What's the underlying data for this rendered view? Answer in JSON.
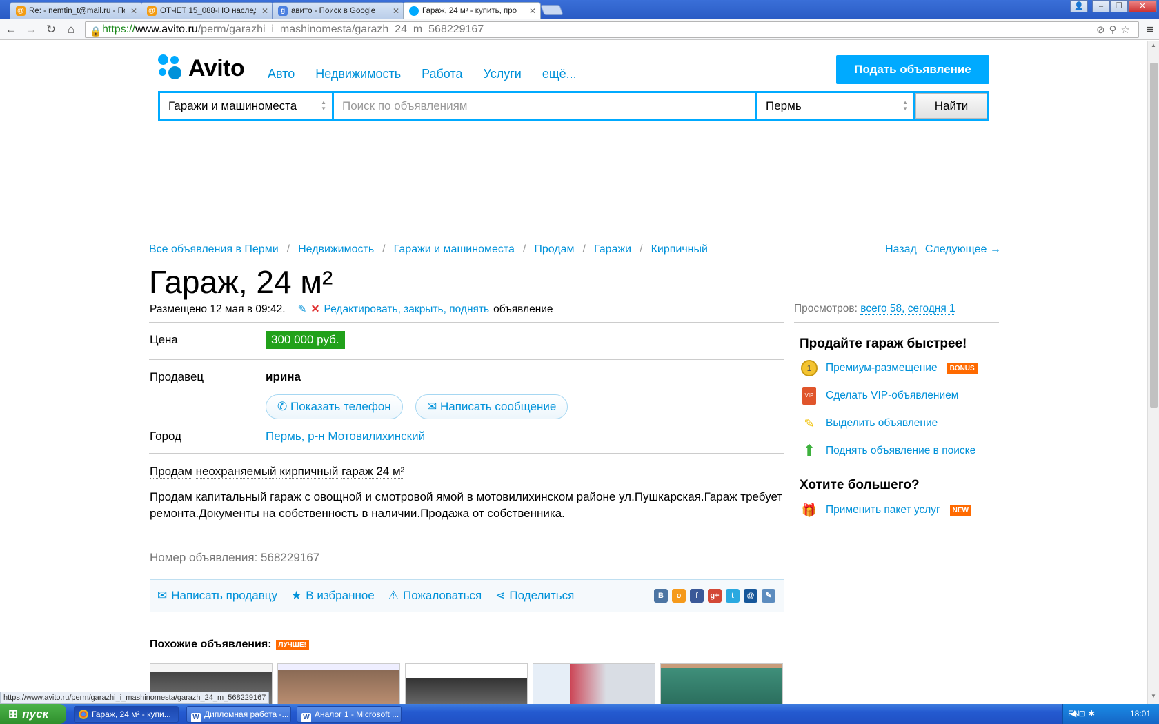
{
  "browser": {
    "tabs": [
      {
        "title": "Re: - nemtin_t@mail.ru - Поч",
        "icon": "mail-icon"
      },
      {
        "title": "ОТЧЕТ 15_088-НО наследс",
        "icon": "mail-icon"
      },
      {
        "title": "авито - Поиск в Google",
        "icon": "google-icon"
      },
      {
        "title": "Гараж, 24 м² - купить, про",
        "icon": "avito-icon"
      }
    ],
    "url_scheme": "https://",
    "url_host": "www.avito.ru",
    "url_path": "/perm/garazhi_i_mashinomesta/garazh_24_m_568229167",
    "status_url": "https://www.avito.ru/perm/garazhi_i_mashinomesta/garazh_24_m_568229167"
  },
  "header": {
    "logo": "Avito",
    "nav": [
      "Авто",
      "Недвижимость",
      "Работа",
      "Услуги",
      "ещё..."
    ],
    "post_button": "Подать объявление",
    "search": {
      "category": "Гаражи и машиноместа",
      "placeholder": "Поиск по объявлениям",
      "city": "Пермь",
      "button": "Найти"
    }
  },
  "breadcrumbs": [
    "Все объявления в Перми",
    "Недвижимость",
    "Гаражи и машиноместа",
    "Продам",
    "Гаражи",
    "Кирпичный"
  ],
  "nav_links": {
    "back": "Назад",
    "next": "Следующее →"
  },
  "listing": {
    "title": "Гараж, 24 м²",
    "posted": "Размещено 12 мая в 09:42.",
    "edit_link": "Редактировать, закрыть, поднять",
    "edit_suffix": "объявление",
    "views_label": "Просмотров:",
    "views_value": "всего 58, сегодня 1",
    "price_label": "Цена",
    "price": "300 000 руб.",
    "seller_label": "Продавец",
    "seller": "ирина",
    "show_phone": "Показать телефон",
    "write_message": "Написать сообщение",
    "city_label": "Город",
    "city": "Пермь, р-н Мотовилихинский",
    "params": [
      "Продам",
      "неохраняемый",
      "кирпичный",
      "гараж 24 м²"
    ],
    "description": "Продам капитальный гараж с овощной и смотровой ямой в мотовилихинском районе ул.Пушкарская.Гараж требует ремонта.Документы на собственность в наличии.Продажа от собственника.",
    "ad_number": "Номер объявления: 568229167"
  },
  "actions": {
    "write_seller": "Написать продавцу",
    "favorite": "В избранное",
    "complain": "Пожаловаться",
    "share": "Поделиться",
    "socials": [
      {
        "name": "vk-icon",
        "glyph": "В",
        "color": "#4c75a3"
      },
      {
        "name": "odnoklassniki-icon",
        "glyph": "о",
        "color": "#f59a1b"
      },
      {
        "name": "facebook-icon",
        "glyph": "f",
        "color": "#3b5998"
      },
      {
        "name": "googleplus-icon",
        "glyph": "g+",
        "color": "#d34836"
      },
      {
        "name": "twitter-icon",
        "glyph": "t",
        "color": "#2aa9e0"
      },
      {
        "name": "mailru-icon",
        "glyph": "@",
        "color": "#16579a"
      },
      {
        "name": "livejournal-icon",
        "glyph": "✎",
        "color": "#5c8cbf"
      }
    ]
  },
  "similar": {
    "label": "Похожие объявления:",
    "badge": "ЛУЧШЕ!"
  },
  "sidebar": {
    "sell_title": "Продайте гараж быстрее!",
    "items": [
      {
        "label": "Премиум-размещение",
        "tag": "BONUS"
      },
      {
        "label": "Сделать VIP-объявлением"
      },
      {
        "label": "Выделить объявление"
      },
      {
        "label": "Поднять объявление в поиске"
      }
    ],
    "more_title": "Хотите большего?",
    "package": {
      "label": "Применить пакет услуг",
      "tag": "NEW"
    }
  },
  "taskbar": {
    "start": "пуск",
    "tasks": [
      "Гараж, 24 м² - купи...",
      "Дипломная работа -...",
      "Аналог 1 - Microsoft ..."
    ],
    "lang": "EN",
    "time": "18:01"
  },
  "colors": {
    "accent": "#0091d9",
    "brand": "#00aaff",
    "price": "#21a11a"
  }
}
